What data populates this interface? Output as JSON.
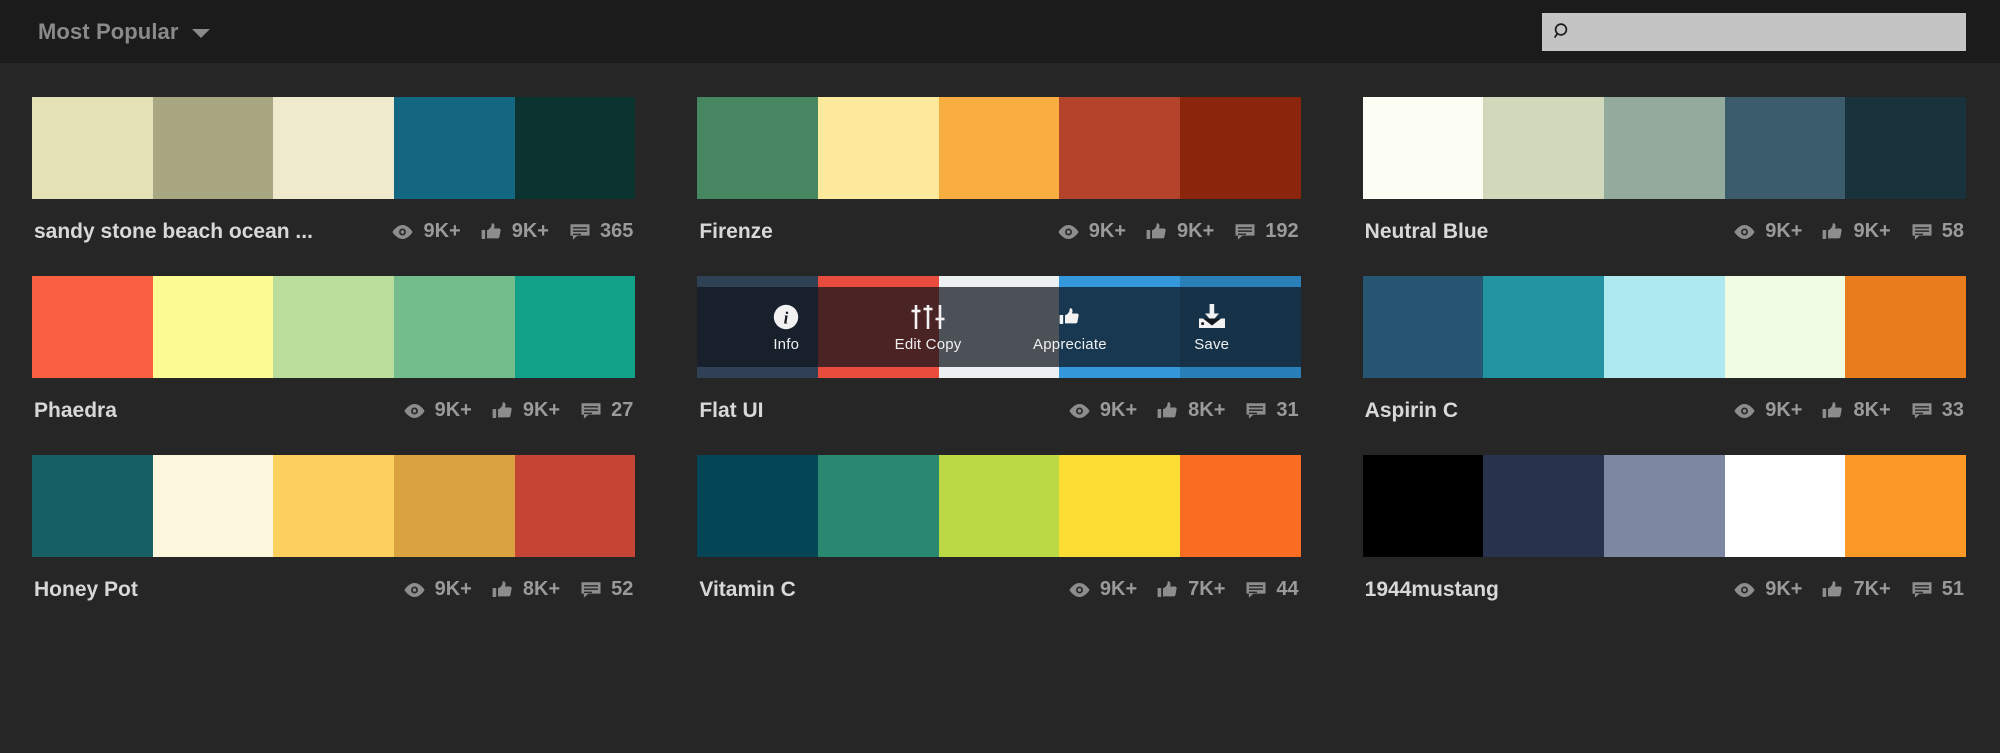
{
  "header": {
    "sort_label": "Most Popular",
    "sort_caret_icon": "chevron-down-icon",
    "search": {
      "icon": "search-icon",
      "value": "",
      "placeholder": ""
    }
  },
  "icons": {
    "views": "eye-icon",
    "appreciations": "thumbs-up-icon",
    "comments": "comment-icon"
  },
  "overlay": {
    "visible_on_card": "Flat UI",
    "actions": [
      {
        "label": "Info",
        "icon": "info-circle-icon"
      },
      {
        "label": "Edit Copy",
        "icon": "sliders-icon"
      },
      {
        "label": "Appreciate",
        "icon": "thumbs-up-icon"
      },
      {
        "label": "Save",
        "icon": "download-tray-icon"
      }
    ]
  },
  "palettes": [
    {
      "name": "sandy stone beach ocean ...",
      "colors": [
        "#e4e1b4",
        "#a9a781",
        "#efe9cd",
        "#136781",
        "#0b332f"
      ],
      "views": "9K+",
      "appreciations": "9K+",
      "comments": "365",
      "overlay": false
    },
    {
      "name": "Firenze",
      "colors": [
        "#468661",
        "#fce99b",
        "#f9ae41",
        "#b3432a",
        "#8b250c"
      ],
      "views": "9K+",
      "appreciations": "9K+",
      "comments": "192",
      "overlay": false
    },
    {
      "name": "Neutral Blue",
      "colors": [
        "#fcfef4",
        "#d1d8bb",
        "#92ab9c",
        "#3b5c6b",
        "#1a323c"
      ],
      "views": "9K+",
      "appreciations": "9K+",
      "comments": "58",
      "overlay": false
    },
    {
      "name": "Phaedra",
      "colors": [
        "#f95f41",
        "#fcfc93",
        "#badd9c",
        "#73bd8c",
        "#11a189"
      ],
      "views": "9K+",
      "appreciations": "9K+",
      "comments": "27",
      "overlay": false
    },
    {
      "name": "Flat UI",
      "colors": [
        "#2f4155",
        "#e74c3c",
        "#ecf0f1",
        "#3498db",
        "#2980b9"
      ],
      "views": "9K+",
      "appreciations": "8K+",
      "comments": "31",
      "overlay": true
    },
    {
      "name": "Aspirin C",
      "colors": [
        "#265672",
        "#2293a0",
        "#aee9ef",
        "#f1fde2",
        "#e97d1e"
      ],
      "views": "9K+",
      "appreciations": "8K+",
      "comments": "33",
      "overlay": false
    },
    {
      "name": "Honey Pot",
      "colors": [
        "#166066",
        "#fdf7dd",
        "#fcd05c",
        "#dba240",
        "#c54434"
      ],
      "views": "9K+",
      "appreciations": "8K+",
      "comments": "52",
      "overlay": false
    },
    {
      "name": "Vitamin C",
      "colors": [
        "#054656",
        "#2a8870",
        "#bad944",
        "#fddc33",
        "#f96d22"
      ],
      "views": "9K+",
      "appreciations": "7K+",
      "comments": "44",
      "overlay": false
    },
    {
      "name": "1944mustang",
      "colors": [
        "#000000",
        "#27334d",
        "#7c88a2",
        "#ffffff",
        "#fb9826"
      ],
      "views": "9K+",
      "appreciations": "7K+",
      "comments": "51",
      "overlay": false
    }
  ]
}
